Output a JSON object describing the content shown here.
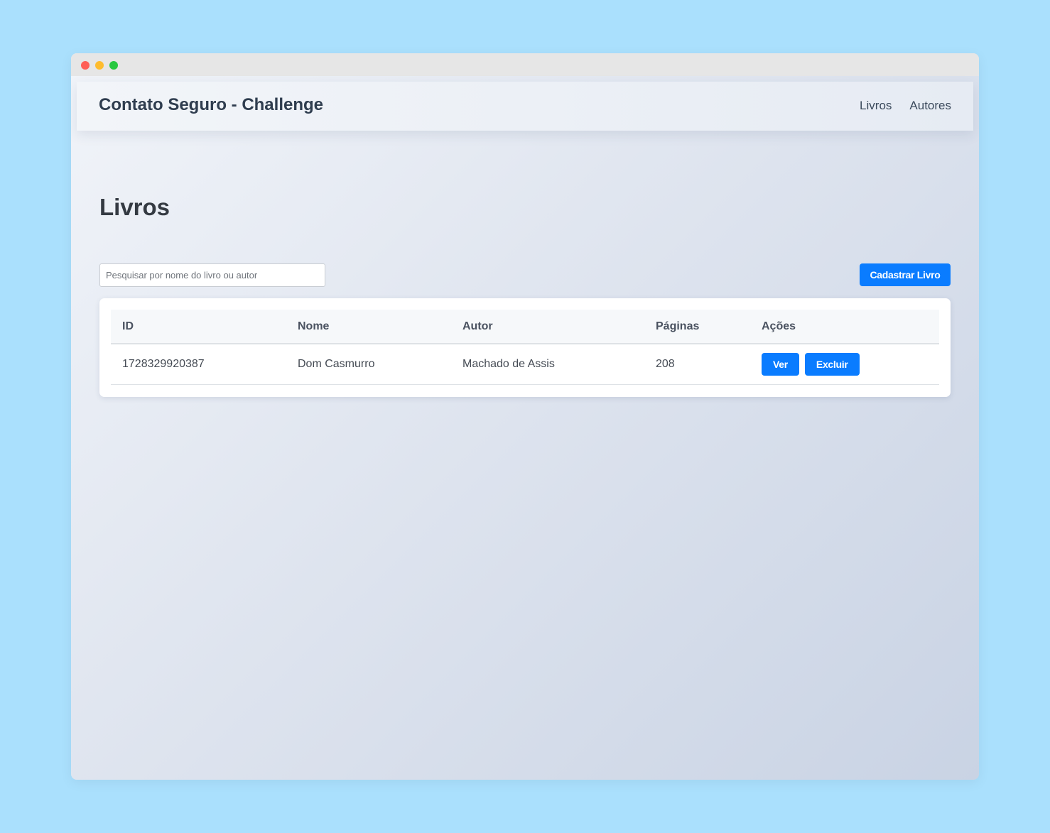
{
  "window": {
    "controls": [
      "close",
      "minimize",
      "maximize"
    ]
  },
  "navbar": {
    "brand": "Contato Seguro - Challenge",
    "links": [
      {
        "label": "Livros"
      },
      {
        "label": "Autores"
      }
    ]
  },
  "page": {
    "title": "Livros"
  },
  "search": {
    "placeholder": "Pesquisar por nome do livro ou autor",
    "value": ""
  },
  "toolbar": {
    "add_label": "Cadastrar Livro"
  },
  "table": {
    "headers": [
      "ID",
      "Nome",
      "Autor",
      "Páginas",
      "Ações"
    ],
    "rows": [
      {
        "id": "1728329920387",
        "nome": "Dom Casmurro",
        "autor": "Machado de Assis",
        "paginas": "208",
        "actions": {
          "view_label": "Ver",
          "delete_label": "Excluir"
        }
      }
    ]
  },
  "colors": {
    "background": "#aae0fd",
    "primary": "#0a7cff",
    "titlebar": "#e6e6e6",
    "close": "#fe5f57",
    "minimize": "#febc2e",
    "maximize": "#28c840"
  }
}
